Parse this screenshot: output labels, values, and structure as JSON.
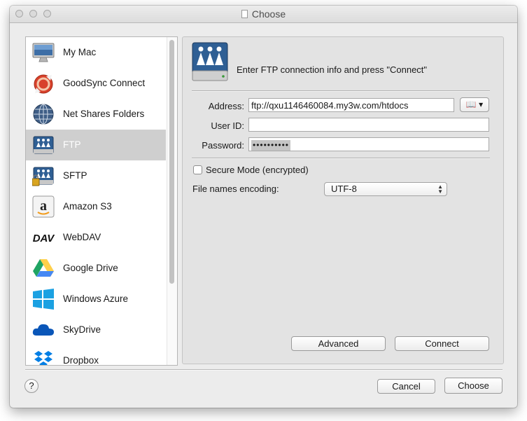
{
  "window": {
    "title": "Choose"
  },
  "sidebar": {
    "items": [
      {
        "label": "My Mac",
        "icon": "imac-icon"
      },
      {
        "label": "GoodSync Connect",
        "icon": "goodsync-icon"
      },
      {
        "label": "Net Shares Folders",
        "icon": "network-globe-icon"
      },
      {
        "label": "FTP",
        "icon": "ftp-drive-icon",
        "selected": true
      },
      {
        "label": "SFTP",
        "icon": "sftp-drive-icon"
      },
      {
        "label": "Amazon S3",
        "icon": "amazon-icon"
      },
      {
        "label": "WebDAV",
        "icon": "webdav-icon"
      },
      {
        "label": "Google Drive",
        "icon": "google-drive-icon"
      },
      {
        "label": "Windows Azure",
        "icon": "windows-icon"
      },
      {
        "label": "SkyDrive",
        "icon": "skydrive-cloud-icon"
      },
      {
        "label": "Dropbox",
        "icon": "dropbox-icon"
      }
    ]
  },
  "panel": {
    "header_text": "Enter FTP connection info and press \"Connect\"",
    "address_label": "Address:",
    "address_value": "ftp://qxu1146460084.my3w.com/htdocs",
    "userid_label": "User ID:",
    "password_label": "Password:",
    "password_value": "••••••••••",
    "secure_mode_label": "Secure Mode (encrypted)",
    "secure_mode_checked": false,
    "encoding_label": "File names encoding:",
    "encoding_value": "UTF-8",
    "advanced_button": "Advanced",
    "connect_button": "Connect"
  },
  "footer": {
    "help_label": "?",
    "cancel_button": "Cancel",
    "choose_button": "Choose"
  },
  "colors": {
    "selection": "#cfcfcf",
    "ftp_drive": "#2f5f94",
    "google_green": "#1fa463",
    "google_yellow": "#ffd04b",
    "google_blue": "#4688f4",
    "windows_blue": "#1ba1e2",
    "dropbox_blue": "#007ee5"
  }
}
